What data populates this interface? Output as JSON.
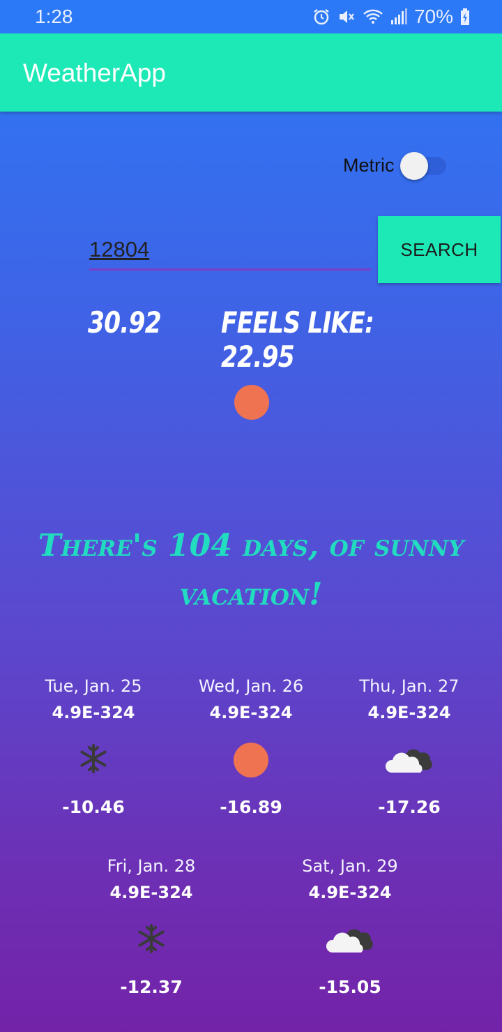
{
  "status_bar": {
    "time": "1:28",
    "battery": "70%",
    "icons": [
      "alarm-icon",
      "mute-icon",
      "wifi-icon",
      "signal-icon",
      "battery-charging-icon"
    ]
  },
  "app_bar": {
    "title": "WeatherApp"
  },
  "units_switch": {
    "label": "Metric",
    "on": false
  },
  "search": {
    "value": "12804",
    "button_label": "SEARCH"
  },
  "current": {
    "temperature": "30.92",
    "feels_like": "FEELS LIKE: 22.95",
    "icon": "sun-icon"
  },
  "message": "There's 104 days, of sunny vacation!",
  "forecast": [
    {
      "date": "Tue, Jan. 25",
      "value": "4.9E-324",
      "icon": "snowflake-icon",
      "temp": "-10.46"
    },
    {
      "date": "Wed, Jan. 26",
      "value": "4.9E-324",
      "icon": "sun-icon",
      "temp": "-16.89"
    },
    {
      "date": "Thu, Jan. 27",
      "value": "4.9E-324",
      "icon": "cloud-icon",
      "temp": "-17.26"
    },
    {
      "date": "Fri, Jan. 28",
      "value": "4.9E-324",
      "icon": "snowflake-icon",
      "temp": "-12.37"
    },
    {
      "date": "Sat, Jan. 29",
      "value": "4.9E-324",
      "icon": "cloud-icon",
      "temp": "-15.05"
    }
  ],
  "colors": {
    "accent": "#1de9b6",
    "gradient_top": "#2b79f6",
    "gradient_bottom": "#7323a8",
    "sun": "#ef7350",
    "message": "#22dcc0"
  }
}
